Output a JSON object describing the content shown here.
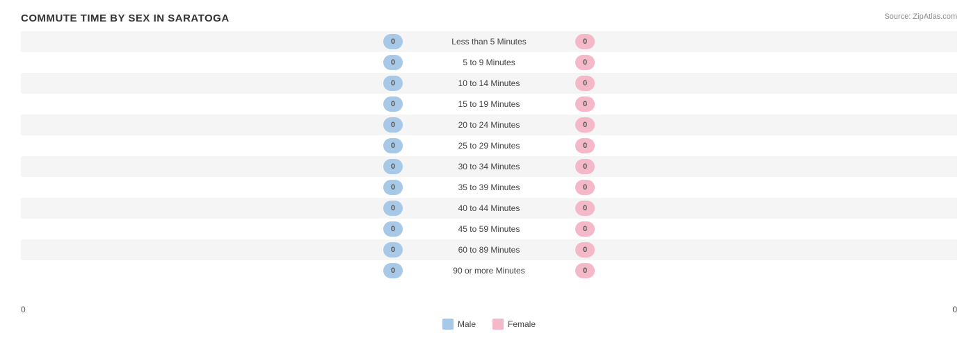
{
  "title": "COMMUTE TIME BY SEX IN SARATOGA",
  "source": "Source: ZipAtlas.com",
  "rows": [
    {
      "label": "Less than 5 Minutes",
      "male": 0,
      "female": 0
    },
    {
      "label": "5 to 9 Minutes",
      "male": 0,
      "female": 0
    },
    {
      "label": "10 to 14 Minutes",
      "male": 0,
      "female": 0
    },
    {
      "label": "15 to 19 Minutes",
      "male": 0,
      "female": 0
    },
    {
      "label": "20 to 24 Minutes",
      "male": 0,
      "female": 0
    },
    {
      "label": "25 to 29 Minutes",
      "male": 0,
      "female": 0
    },
    {
      "label": "30 to 34 Minutes",
      "male": 0,
      "female": 0
    },
    {
      "label": "35 to 39 Minutes",
      "male": 0,
      "female": 0
    },
    {
      "label": "40 to 44 Minutes",
      "male": 0,
      "female": 0
    },
    {
      "label": "45 to 59 Minutes",
      "male": 0,
      "female": 0
    },
    {
      "label": "60 to 89 Minutes",
      "male": 0,
      "female": 0
    },
    {
      "label": "90 or more Minutes",
      "male": 0,
      "female": 0
    }
  ],
  "axis": {
    "left": "0",
    "right": "0"
  },
  "legend": {
    "male_label": "Male",
    "female_label": "Female",
    "male_color": "#a8c8e8",
    "female_color": "#f4b8c8"
  }
}
